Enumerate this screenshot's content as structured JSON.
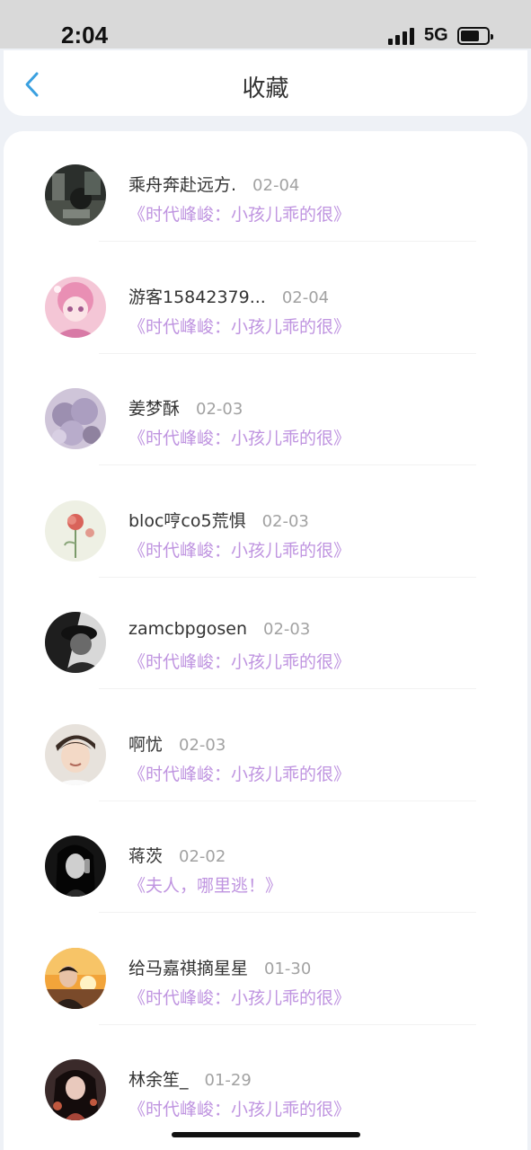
{
  "status_bar": {
    "time": "2:04",
    "network": "5G",
    "battery_level": 0.7
  },
  "nav": {
    "title": "收藏",
    "back_icon": "chevron-left-icon",
    "accent": "#3aa0e0"
  },
  "colors": {
    "book_title": "#bf94e0",
    "date": "#a2a2a2",
    "name": "#333333"
  },
  "favorites": [
    {
      "name": "乘舟奔赴远方.",
      "date": "02-04",
      "book": "《时代峰峻：小孩儿乖的很》",
      "avatar": "dark-street-photo"
    },
    {
      "name": "游客15842379...",
      "date": "02-04",
      "book": "《时代峰峻：小孩儿乖的很》",
      "avatar": "pink-anime-girl"
    },
    {
      "name": "姜梦酥",
      "date": "02-03",
      "book": "《时代峰峻：小孩儿乖的很》",
      "avatar": "lavender-curly-hair"
    },
    {
      "name": "bloc哼co5荒惧",
      "date": "02-03",
      "book": "《时代峰峻：小孩儿乖的很》",
      "avatar": "red-flower"
    },
    {
      "name": "zamcbpgosen",
      "date": "02-03",
      "book": "《时代峰峻：小孩儿乖的很》",
      "avatar": "bw-portrait-cap"
    },
    {
      "name": "啊忧",
      "date": "02-03",
      "book": "《时代峰峻：小孩儿乖的很》",
      "avatar": "smiling-boy"
    },
    {
      "name": "蒋茨",
      "date": "02-02",
      "book": "《夫人，哪里逃！》",
      "avatar": "woman-phone-bw"
    },
    {
      "name": "给马嘉祺摘星星",
      "date": "01-30",
      "book": "《时代峰峻：小孩儿乖的很》",
      "avatar": "boy-sunset"
    },
    {
      "name": "林余笙_",
      "date": "01-29",
      "book": "《时代峰峻：小孩儿乖的很》",
      "avatar": "woman-long-hair-dark"
    }
  ]
}
